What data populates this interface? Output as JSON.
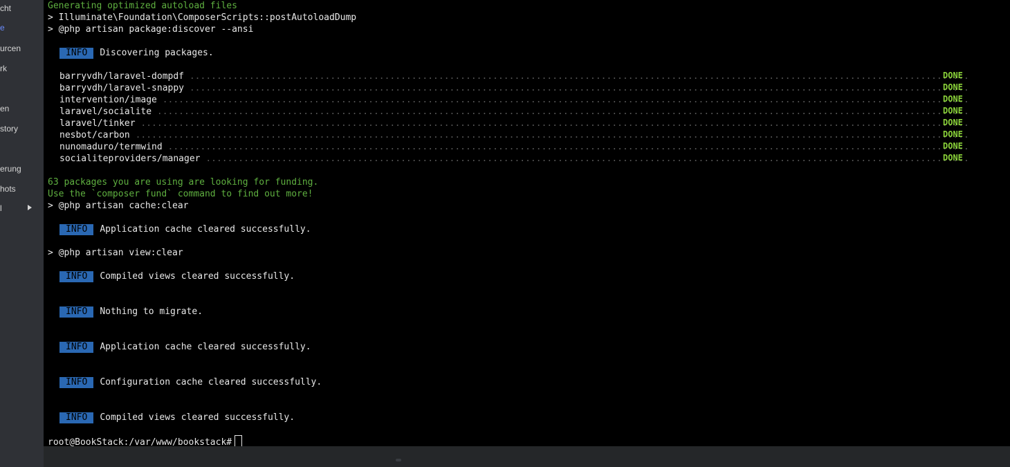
{
  "sidebar": {
    "items": [
      {
        "label": "cht"
      },
      {
        "label": "e"
      },
      {
        "label": "urcen"
      },
      {
        "label": "rk"
      },
      {
        "label": "en"
      },
      {
        "label": "story"
      },
      {
        "label": "erung"
      },
      {
        "label": "hots"
      },
      {
        "label": "l"
      }
    ]
  },
  "terminal": {
    "lines": [
      "Generating optimized autoload files",
      "> Illuminate\\Foundation\\ComposerScripts::postAutoloadDump",
      "> @php artisan package:discover --ansi"
    ],
    "info_label": "INFO",
    "discover_msg": "Discovering packages.",
    "packages": [
      {
        "name": "barryvdh/laravel-dompdf",
        "status": "DONE"
      },
      {
        "name": "barryvdh/laravel-snappy",
        "status": "DONE"
      },
      {
        "name": "intervention/image",
        "status": "DONE"
      },
      {
        "name": "laravel/socialite",
        "status": "DONE"
      },
      {
        "name": "laravel/tinker",
        "status": "DONE"
      },
      {
        "name": "nesbot/carbon",
        "status": "DONE"
      },
      {
        "name": "nunomaduro/termwind",
        "status": "DONE"
      },
      {
        "name": "socialiteproviders/manager",
        "status": "DONE"
      }
    ],
    "funding_1": "63 packages you are using are looking for funding.",
    "funding_2": "Use the `composer fund` command to find out more!",
    "cmd_cache_clear": "> @php artisan cache:clear",
    "msg_cache_cleared": "Application cache cleared successfully.",
    "cmd_view_clear": "> @php artisan view:clear",
    "msg_views_cleared": "Compiled views cleared successfully.",
    "msg_nothing_migrate": "Nothing to migrate.",
    "msg_cache_cleared_2": "Application cache cleared successfully.",
    "msg_config_cleared": "Configuration cache cleared successfully.",
    "msg_views_cleared_2": "Compiled views cleared successfully.",
    "prompt": "root@BookStack:/var/www/bookstack#"
  },
  "colors": {
    "terminal_bg": "#000000",
    "info_badge_bg": "#2a68b3",
    "done_green": "#8bd33a",
    "composer_green": "#5fb040",
    "sidebar_bg": "#2f3136"
  }
}
